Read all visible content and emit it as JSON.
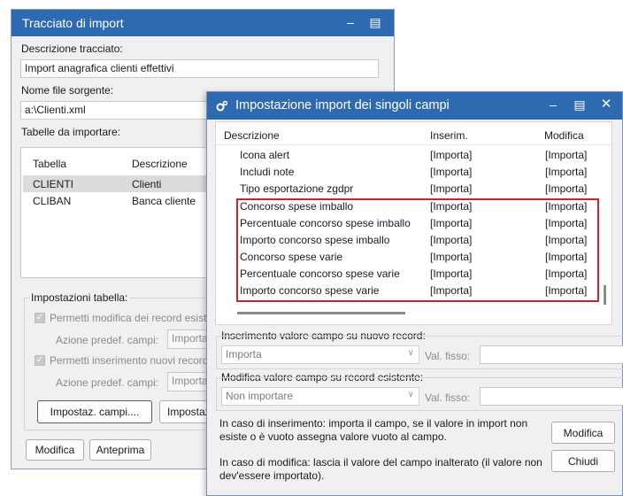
{
  "back_window": {
    "title": "Tracciato di import",
    "descrizione_label": "Descrizione tracciato:",
    "descrizione_value": "Import anagrafica clienti effettivi",
    "nome_file_label": "Nome file sorgente:",
    "nome_file_value": "a:\\Clienti.xml",
    "tabelle_label": "Tabelle da importare:",
    "table": {
      "headers": [
        "Tabella",
        "Descrizione"
      ],
      "rows": [
        {
          "tabella": "CLIENTI",
          "descrizione": "Clienti"
        },
        {
          "tabella": "CLIBAN",
          "descrizione": "Banca cliente"
        }
      ]
    },
    "impostazioni_label": "Impostazioni tabella:",
    "permetti_modifica": "Permetti modifica dei record esist",
    "azione_predef_1": "Azione predef. campi:",
    "azione_value_1": "Importa",
    "permetti_inserimento": "Permetti inserimento nuovi record",
    "azione_predef_2": "Azione predef. campi:",
    "azione_value_2": "Importa",
    "btn_impostaz_campi": "Impostaz. campi....",
    "btn_impostaz2": "Impostaz",
    "btn_modifica": "Modifica",
    "btn_anteprima": "Anteprima"
  },
  "front_window": {
    "title": "Impostazione import dei singoli campi",
    "columns": [
      "Descrizione",
      "Inserim.",
      "Modifica"
    ],
    "rows": [
      {
        "descrizione": "Icona alert",
        "inserim": "[Importa]",
        "modifica": "[Importa]"
      },
      {
        "descrizione": "Includi note",
        "inserim": "[Importa]",
        "modifica": "[Importa]"
      },
      {
        "descrizione": "Tipo esportazione zgdpr",
        "inserim": "[Importa]",
        "modifica": "[Importa]"
      },
      {
        "descrizione": "Concorso spese imballo",
        "inserim": "[Importa]",
        "modifica": "[Importa]"
      },
      {
        "descrizione": "Percentuale concorso spese imballo",
        "inserim": "[Importa]",
        "modifica": "[Importa]"
      },
      {
        "descrizione": "Importo concorso spese imballo",
        "inserim": "[Importa]",
        "modifica": "[Importa]"
      },
      {
        "descrizione": "Concorso spese varie",
        "inserim": "[Importa]",
        "modifica": "[Importa]"
      },
      {
        "descrizione": "Percentuale concorso spese varie",
        "inserim": "[Importa]",
        "modifica": "[Importa]"
      },
      {
        "descrizione": "Importo concorso spese varie",
        "inserim": "[Importa]",
        "modifica": "[Importa]"
      }
    ],
    "inserimento_label": "Inserimento valore campo su nuovo record:",
    "inserimento_value": "Importa",
    "val_fisso_1": "Val. fisso:",
    "modifica_label": "Modifica valore campo su record esistente:",
    "modifica_value": "Non importare",
    "val_fisso_2": "Val. fisso:",
    "info_inserimento": "In caso di inserimento: importa il campo, se il valore in import non esiste o è vuoto assegna valore vuoto al campo.",
    "info_modifica": "In caso di modifica: lascia il valore del campo inalterato (il valore non dev'essere importato).",
    "btn_modifica": "Modifica",
    "btn_chiudi": "Chiudi"
  },
  "colors": {
    "titlebar": "#2e6ab1",
    "highlight_border": "#d0202a",
    "selected_row": "#dcdcdc"
  }
}
